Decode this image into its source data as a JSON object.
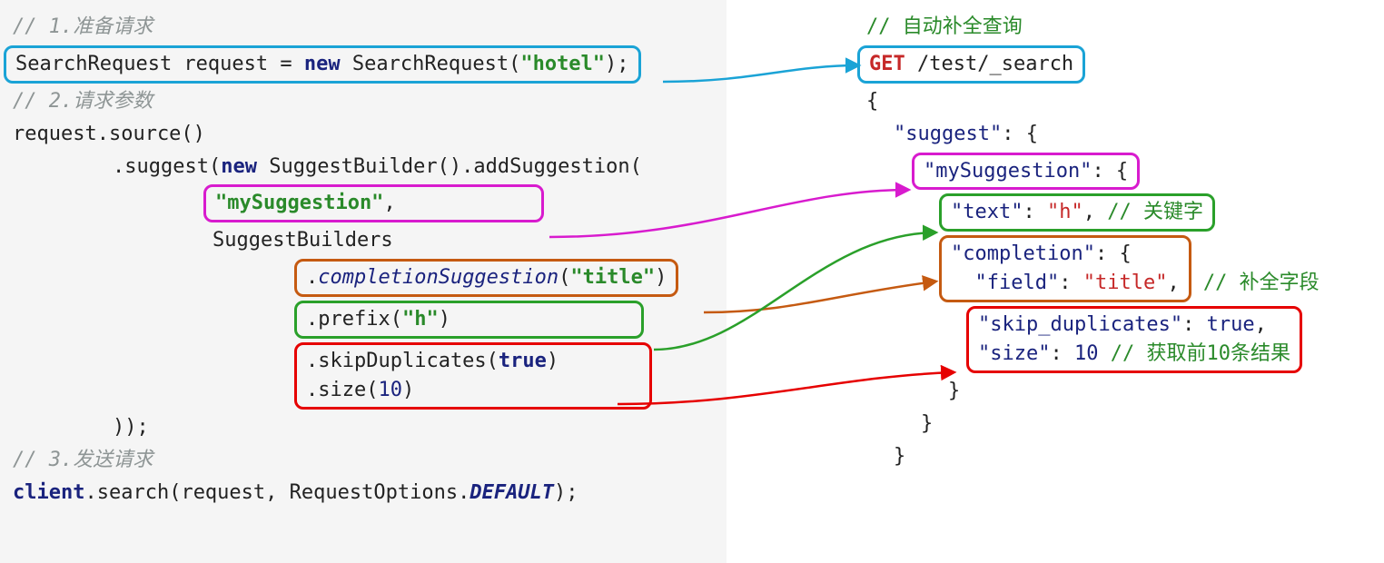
{
  "colors": {
    "cyan": "#1aa3d6",
    "magenta": "#d81bce",
    "orange": "#c55a11",
    "green": "#2aa02a",
    "red": "#e60000"
  },
  "java": {
    "comment1": "// 1.准备请求",
    "line_request_pre": "SearchRequest request = ",
    "kw_new": "new",
    "line_request_post": " SearchRequest(",
    "str_hotel": "\"hotel\"",
    "line_request_end": ");",
    "comment2": "// 2.请求参数",
    "line_source": "request.source()",
    "line_suggest_pre": ".suggest(",
    "line_suggest_post": " SuggestBuilder().addSuggestion(",
    "mySuggestion": "\"mySuggestion\"",
    "comma": ",",
    "suggestBuilders": "SuggestBuilders",
    "completion_pre": ".",
    "completion_method": "completionSuggestion",
    "completion_open": "(",
    "str_title": "\"title\"",
    "completion_close": ")",
    "prefix_pre": ".prefix(",
    "str_h": "\"h\"",
    "prefix_close": ")",
    "skip_pre": ".skipDuplicates(",
    "kw_true": "true",
    "skip_close": ")",
    "size_pre": ".size(",
    "num_10": "10",
    "size_close": ")",
    "close_paren": "));",
    "comment3": "// 3.发送请求",
    "client": "client",
    "search_call": ".search(request, RequestOptions.",
    "default_const": "DEFAULT",
    "search_end": ");"
  },
  "dsl": {
    "comment_top": "// 自动补全查询",
    "http_method": "GET",
    "http_path": " /test/_search",
    "brace_open": "{",
    "brace_close": "}",
    "suggest_key": "\"suggest\"",
    "colon_brace": ": {",
    "mySuggestion_key": "\"mySuggestion\"",
    "text_key": "\"text\"",
    "colon": ": ",
    "str_h": "\"h\"",
    "comma": ",",
    "comment_keyword": " // 关键字",
    "completion_key": "\"completion\"",
    "field_key": "\"field\"",
    "str_title": "\"title\"",
    "comment_field": " // 补全字段",
    "skip_key": "\"skip_duplicates\"",
    "val_true": "true",
    "size_key": "\"size\"",
    "val_10": "10",
    "comment_size": " // 获取前10条结果"
  }
}
